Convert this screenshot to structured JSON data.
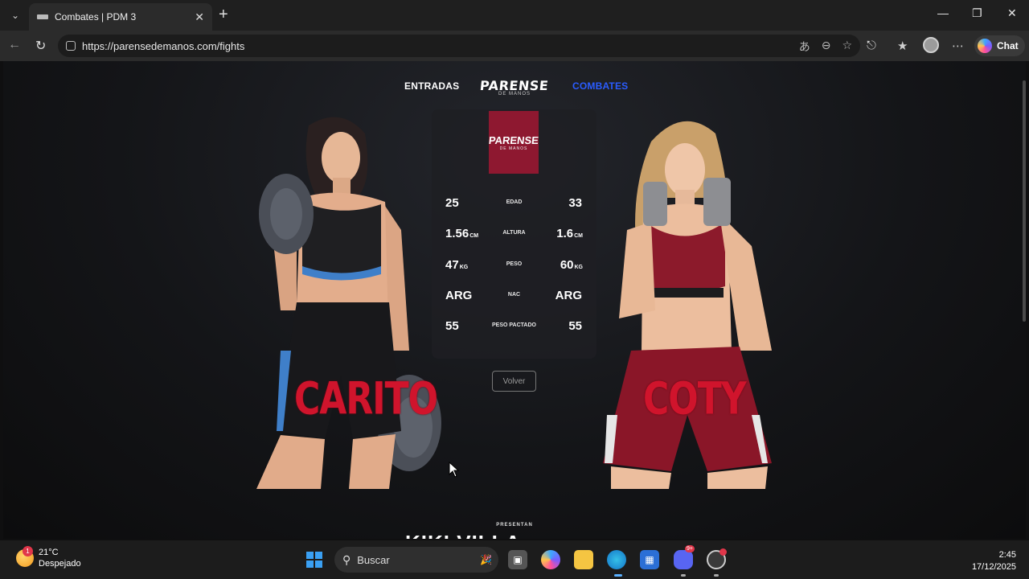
{
  "browser": {
    "tab_title": "Combates | PDM 3",
    "url": "https://parensedemanos.com/fights",
    "chat_label": "Chat"
  },
  "site": {
    "nav_left": "ENTRADAS",
    "nav_right": "COMBATES",
    "logo_main": "PARENSE",
    "logo_sub": "DE MANOS",
    "accent_color": "#2a5cff",
    "badge_color": "#8e1830"
  },
  "fighters": {
    "left": {
      "name": "CARITO",
      "color": "#d0142c"
    },
    "right": {
      "name": "COTY",
      "color": "#d0142c"
    }
  },
  "stats": [
    {
      "label": "EDAD",
      "left": "25",
      "left_unit": "",
      "right": "33",
      "right_unit": ""
    },
    {
      "label": "ALTURA",
      "left": "1.56",
      "left_unit": "CM",
      "right": "1.6",
      "right_unit": "CM"
    },
    {
      "label": "PESO",
      "left": "47",
      "left_unit": "KG",
      "right": "60",
      "right_unit": "KG"
    },
    {
      "label": "NAC",
      "left": "ARG",
      "left_unit": "",
      "right": "ARG",
      "right_unit": ""
    },
    {
      "label": "PESO PACTADO",
      "left": "55",
      "left_unit": "",
      "right": "55",
      "right_unit": ""
    }
  ],
  "back_button": "Volver",
  "footer": {
    "presentan": "PRESENTAN",
    "sponsor": "KIKI VILLA MOSTAZA"
  },
  "taskbar": {
    "temp": "21°C",
    "weather": "Despejado",
    "weather_badge": "1",
    "search_placeholder": "Buscar",
    "time": "2:45",
    "date": "17/12/2025",
    "discord_badge": "9+"
  }
}
